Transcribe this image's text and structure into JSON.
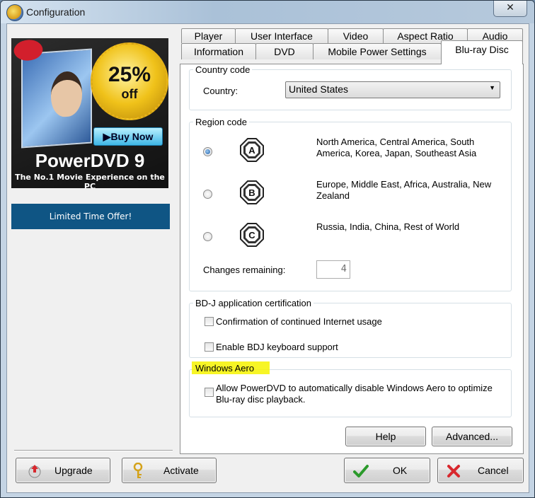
{
  "window": {
    "title": "Configuration",
    "close_glyph": "✕"
  },
  "ad": {
    "discount": "25%",
    "off": "off",
    "buy_now": "▶Buy Now",
    "product": "PowerDVD 9",
    "tagline": "The No.1 Movie Experience on the PC",
    "offer": "Limited Time Offer!"
  },
  "tabs": {
    "row1": [
      "Player",
      "User Interface",
      "Video",
      "Aspect Ratio",
      "Audio"
    ],
    "row2": [
      "Information",
      "DVD",
      "Mobile Power Settings",
      "Blu-ray Disc"
    ],
    "active": "Blu-ray Disc"
  },
  "country": {
    "group_label": "Country code",
    "label": "Country:",
    "value": "United States"
  },
  "region": {
    "group_label": "Region code",
    "options": [
      {
        "letter": "A",
        "text": "North America, Central America, South America, Korea, Japan, Southeast Asia",
        "selected": true
      },
      {
        "letter": "B",
        "text": "Europe, Middle East, Africa, Australia, New Zealand",
        "selected": false
      },
      {
        "letter": "C",
        "text": "Russia, India, China, Rest of World",
        "selected": false
      }
    ],
    "changes_label": "Changes remaining:",
    "changes_value": "4"
  },
  "bdj": {
    "group_label": "BD-J application certification",
    "opt1": "Confirmation of continued Internet usage",
    "opt2": "Enable BDJ keyboard support"
  },
  "aero": {
    "group_label": "Windows Aero",
    "option": "Allow PowerDVD to automatically disable Windows Aero to optimize Blu-ray disc playback.",
    "highlight_color": "#f6f300"
  },
  "buttons": {
    "help": "Help",
    "advanced": "Advanced...",
    "upgrade": "Upgrade",
    "activate": "Activate",
    "ok": "OK",
    "cancel": "Cancel"
  }
}
